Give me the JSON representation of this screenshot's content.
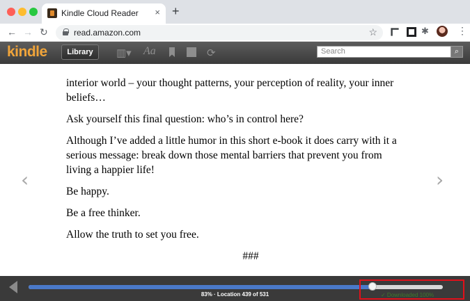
{
  "browser": {
    "tab_title": "Kindle Cloud Reader",
    "tab_close": "×",
    "new_tab": "+",
    "url": "read.amazon.com",
    "back": "←",
    "forward": "→",
    "reload": "↻",
    "star": "☆",
    "menu": "⋮"
  },
  "kindle": {
    "logo": "kindle",
    "library_label": "Library",
    "search_placeholder": "Search",
    "search_btn": "🔍"
  },
  "book": {
    "paragraphs": [
      "interior world – your thought patterns, your perception of reality, your inner beliefs…",
      "Ask yourself this final question: who’s in control here?",
      "Although I’ve added a little humor in this short e-book it does carry with it a serious message: break down those mental barriers that prevent you from living a happier life!",
      "Be happy.",
      "Be a free thinker.",
      "Allow the truth to set you free."
    ],
    "end_mark": "###"
  },
  "progress": {
    "percent": 83,
    "location_text": "83% · Location 439 of 531",
    "downloaded_text": "✓ Downloaded 100%"
  }
}
